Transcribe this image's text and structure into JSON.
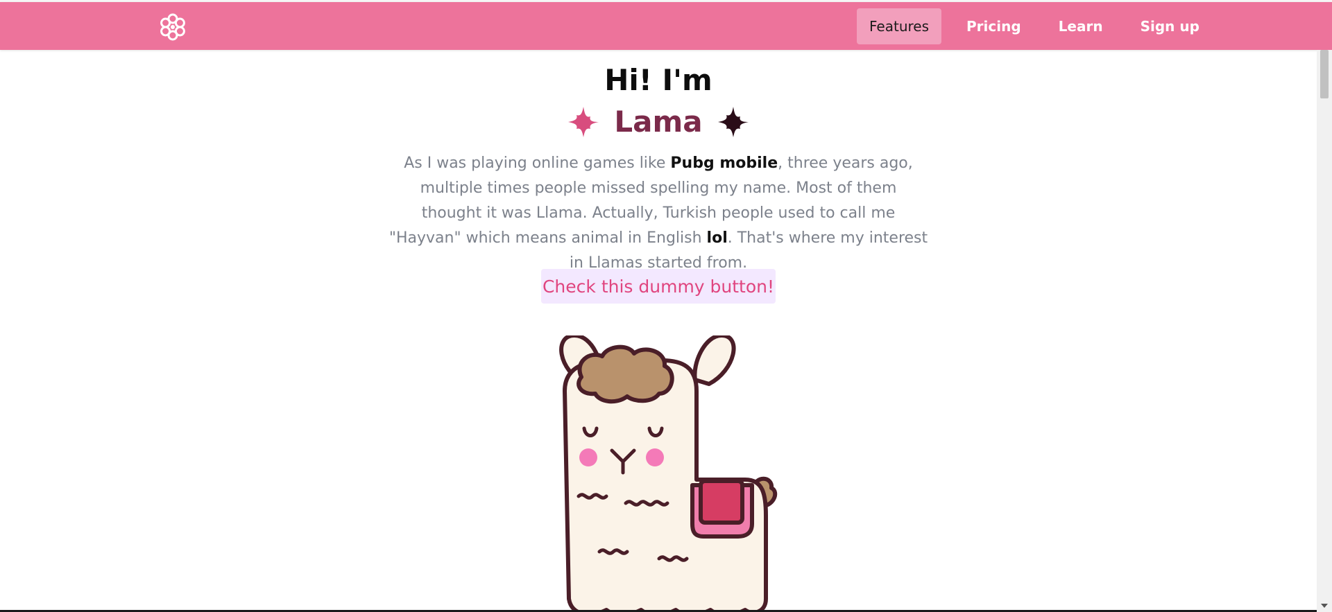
{
  "nav": {
    "logo_icon": "flower-icon",
    "items": [
      {
        "label": "Features",
        "active": true
      },
      {
        "label": "Pricing",
        "active": false
      },
      {
        "label": "Learn",
        "active": false
      },
      {
        "label": "Sign up",
        "active": false
      }
    ]
  },
  "hero": {
    "greeting": "Hi! I'm",
    "name": "Lama",
    "intro_parts": {
      "p1": "As I was playing online games like ",
      "bold1": "Pubg mobile",
      "p2": ", three years ago, multiple times people missed spelling my name. Most of them thought it was Llama. Actually, Turkish people used to call me \"Hayvan\" which means animal in English ",
      "bold2": "lol",
      "p3": ". That's where my interest in Llamas started from."
    },
    "button_label": "Check this dummy button!",
    "image_icon": "llama-illustration"
  },
  "colors": {
    "navbar": "#ed739b",
    "nav_active": "#f29fbc",
    "name": "#7b2a4a",
    "button_bg": "#f3e8ff",
    "button_text": "#e0457f",
    "sparkle_left": "#d84d7e",
    "sparkle_right": "#2a0d18"
  }
}
